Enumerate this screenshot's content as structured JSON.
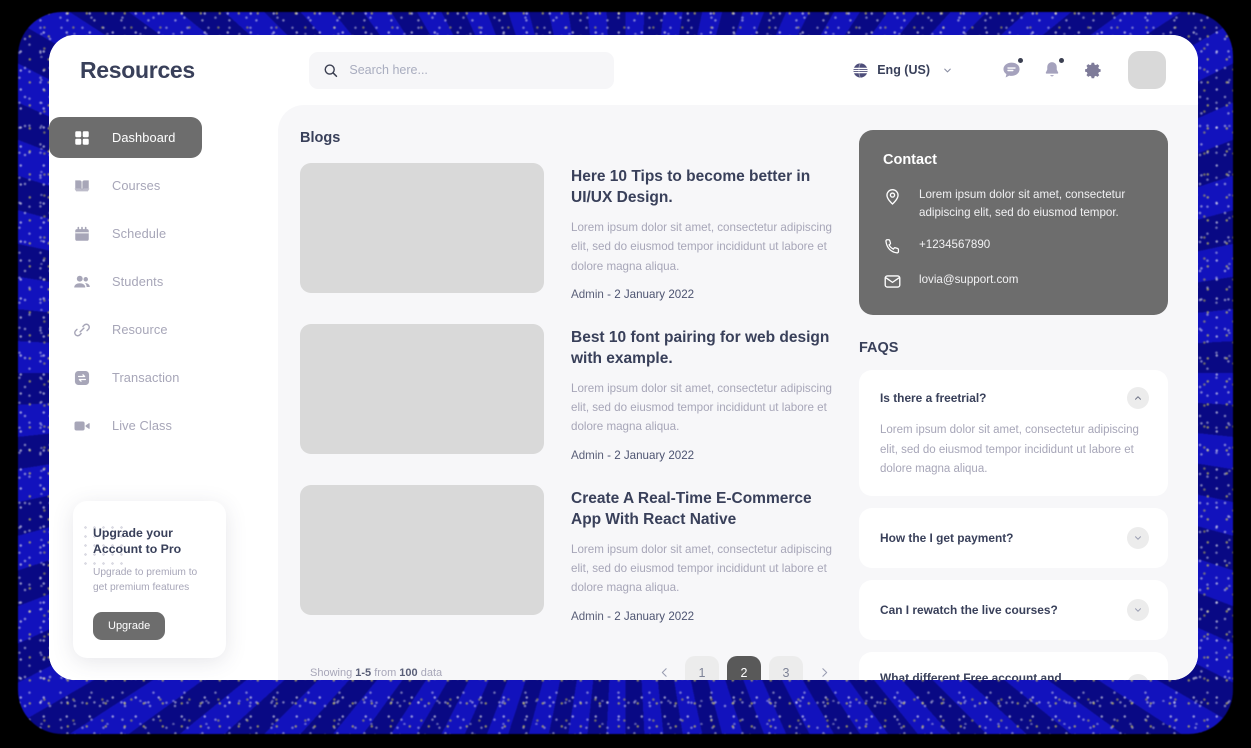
{
  "header": {
    "title": "Resources",
    "search_placeholder": "Search here...",
    "search_value": "",
    "language": "Eng (US)"
  },
  "sidebar": {
    "items": [
      {
        "label": "Dashboard",
        "icon": "grid-icon",
        "active": true
      },
      {
        "label": "Courses",
        "icon": "book-icon",
        "active": false
      },
      {
        "label": "Schedule",
        "icon": "calendar-icon",
        "active": false
      },
      {
        "label": "Students",
        "icon": "users-icon",
        "active": false
      },
      {
        "label": "Resource",
        "icon": "link-icon",
        "active": false
      },
      {
        "label": "Transaction",
        "icon": "transfer-icon",
        "active": false
      },
      {
        "label": "Live Class",
        "icon": "video-icon",
        "active": false
      }
    ],
    "upgrade": {
      "title": "Upgrade your Account to Pro",
      "subtitle": "Upgrade to premium to get premium features",
      "button": "Upgrade"
    }
  },
  "blogs": {
    "section_title": "Blogs",
    "items": [
      {
        "title": "Here 10 Tips to become better in UI/UX Design.",
        "desc": "Lorem ipsum dolor sit amet, consectetur adipiscing elit, sed do eiusmod tempor incididunt ut labore et dolore magna aliqua.",
        "author": "Admin",
        "date": "2 January 2022"
      },
      {
        "title": "Best 10 font pairing for web design with example.",
        "desc": "Lorem ipsum dolor sit amet, consectetur adipiscing elit, sed do eiusmod tempor incididunt ut labore et dolore magna aliqua.",
        "author": "Admin",
        "date": "2 January 2022"
      },
      {
        "title": "Create A Real-Time E-Commerce App With React Native",
        "desc": "Lorem ipsum dolor sit amet, consectetur adipiscing elit, sed do eiusmod tempor incididunt ut labore et dolore magna aliqua.",
        "author": "Admin",
        "date": "2 January 2022"
      }
    ]
  },
  "pagination": {
    "showing_prefix": "Showing ",
    "range": "1-5",
    "from": " from ",
    "total": "100",
    "suffix": " data",
    "pages": [
      "1",
      "2",
      "3"
    ],
    "active_page": "2"
  },
  "contact": {
    "title": "Contact",
    "address": "Lorem ipsum dolor sit amet, consectetur adipiscing elit, sed do eiusmod tempor.",
    "phone": "+1234567890",
    "email": "lovia@support.com"
  },
  "faqs": {
    "title": "FAQS",
    "items": [
      {
        "question": "Is there a freetrial?",
        "answer": "Lorem ipsum dolor sit amet, consectetur adipiscing elit, sed do eiusmod tempor incididunt ut labore et dolore magna aliqua.",
        "expanded": true
      },
      {
        "question": "How the I get payment?",
        "answer": "",
        "expanded": false
      },
      {
        "question": "Can I  rewatch the live courses?",
        "answer": "",
        "expanded": false
      },
      {
        "question": "What different Free account and Premium?",
        "answer": "",
        "expanded": false
      }
    ]
  },
  "colors": {
    "accent_dark": "#6d6d6d",
    "text_heading": "#39405a",
    "text_muted": "#a7a6b8",
    "surface": "#f7f7f9",
    "placeholder_image": "#d9d9d9",
    "glow": "#1111aa"
  }
}
